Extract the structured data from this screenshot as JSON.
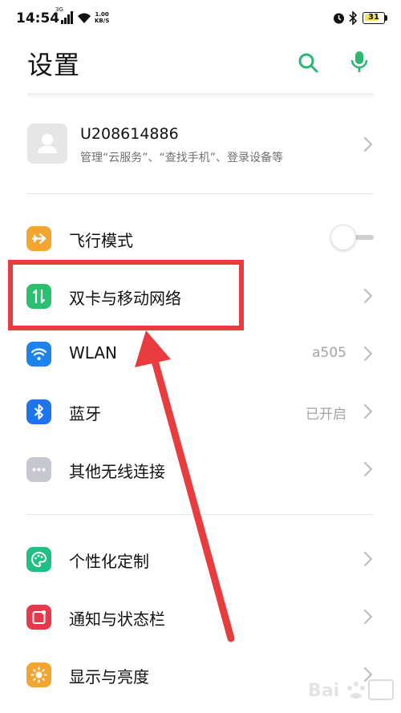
{
  "status_bar": {
    "time": "14:54",
    "network_type": "3G",
    "speed_value": "1.00",
    "speed_unit": "KB/S",
    "battery_level": "31",
    "icons": [
      "signal-icon",
      "wifi-icon",
      "alarm-icon",
      "bluetooth-icon",
      "battery-icon"
    ]
  },
  "header": {
    "title": "设置",
    "search_icon": "search-icon",
    "voice_icon": "microphone-icon",
    "accent_color": "#2bb673"
  },
  "account": {
    "name": "U208614886",
    "description": "管理“云服务”、“查找手机”、登录设备等"
  },
  "rows": [
    {
      "label": "飞行模式",
      "icon": "airplane-icon",
      "icon_color": "#f3a52f",
      "control": "toggle",
      "toggle_on": false
    },
    {
      "label": "双卡与移动网络",
      "icon": "sim-data-icon",
      "icon_color": "#2bbf70",
      "control": "chevron",
      "highlighted": true
    },
    {
      "label": "WLAN",
      "icon": "wifi-icon",
      "icon_color": "#1d83ef",
      "value": "a505",
      "control": "chevron"
    },
    {
      "label": "蓝牙",
      "icon": "bluetooth-icon",
      "icon_color": "#1d74ef",
      "value": "已开启",
      "control": "chevron"
    },
    {
      "label": "其他无线连接",
      "icon": "more-dots-icon",
      "icon_color": "#c7c7cf",
      "control": "chevron"
    },
    {
      "label": "个性化定制",
      "icon": "palette-icon",
      "icon_color": "#1fbf86",
      "control": "chevron"
    },
    {
      "label": "通知与状态栏",
      "icon": "notification-icon",
      "icon_color": "#e8394a",
      "control": "chevron"
    },
    {
      "label": "显示与亮度",
      "icon": "brightness-icon",
      "icon_color": "#f3a52f",
      "control": "chevron"
    }
  ],
  "annotation": {
    "color": "#e83c3f"
  }
}
